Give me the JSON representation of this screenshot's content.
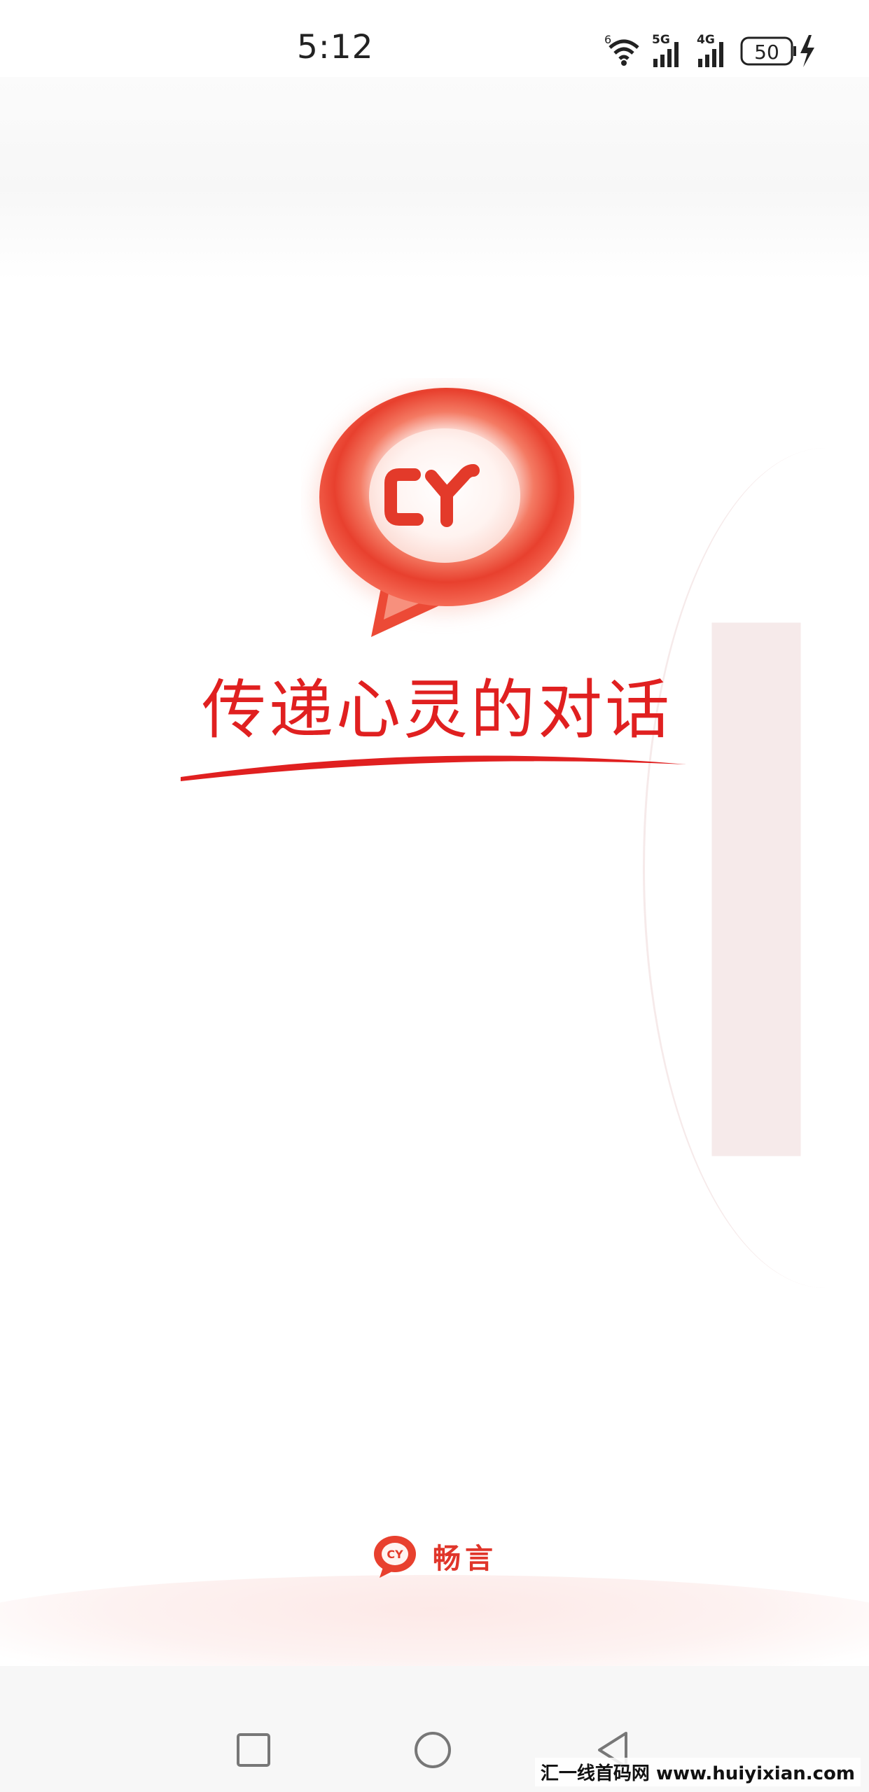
{
  "status_bar": {
    "time": "5:12",
    "wifi_label": "6",
    "net1_label": "5G",
    "net2_label": "4G",
    "battery": "50",
    "icons": [
      "wifi-icon",
      "signal-5g-icon",
      "signal-4g-icon",
      "battery-icon",
      "charging-icon"
    ]
  },
  "splash": {
    "logo_letters": "CY",
    "slogan": "传递心灵的对话"
  },
  "footer": {
    "brand_name": "畅言",
    "brand_logo_letters": "CY"
  },
  "nav": {
    "icons": [
      "recent-apps-icon",
      "home-icon",
      "back-icon"
    ]
  },
  "watermark": "汇一线首码网 www.huiyixian.com",
  "colors": {
    "brand_red": "#e5322b",
    "slogan_red": "#e02020"
  }
}
